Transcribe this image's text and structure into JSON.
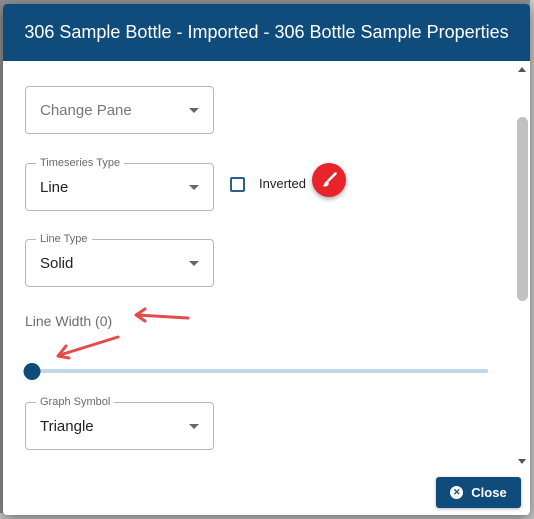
{
  "dialog": {
    "title": "306 Sample Bottle - Imported - 306 Bottle Sample Properties"
  },
  "change_pane": {
    "placeholder": "Change Pane"
  },
  "timeseries_type": {
    "label": "Timeseries Type",
    "value": "Line"
  },
  "inverted": {
    "label": "Inverted",
    "checked": false
  },
  "paint_button": {
    "icon": "paintbrush-icon",
    "color": "#e8232a"
  },
  "line_type": {
    "label": "Line Type",
    "value": "Solid"
  },
  "line_width": {
    "label": "Line Width (0)",
    "value": 0,
    "fill_fraction": 0
  },
  "graph_symbol": {
    "label": "Graph Symbol",
    "value": "Triangle"
  },
  "footer": {
    "close_label": "Close",
    "close_icon": "close-circle-icon"
  },
  "annotations": {
    "arrow_color": "#e84a4a"
  },
  "theme": {
    "primary": "#0f4c7c",
    "accent": "#e8232a"
  }
}
